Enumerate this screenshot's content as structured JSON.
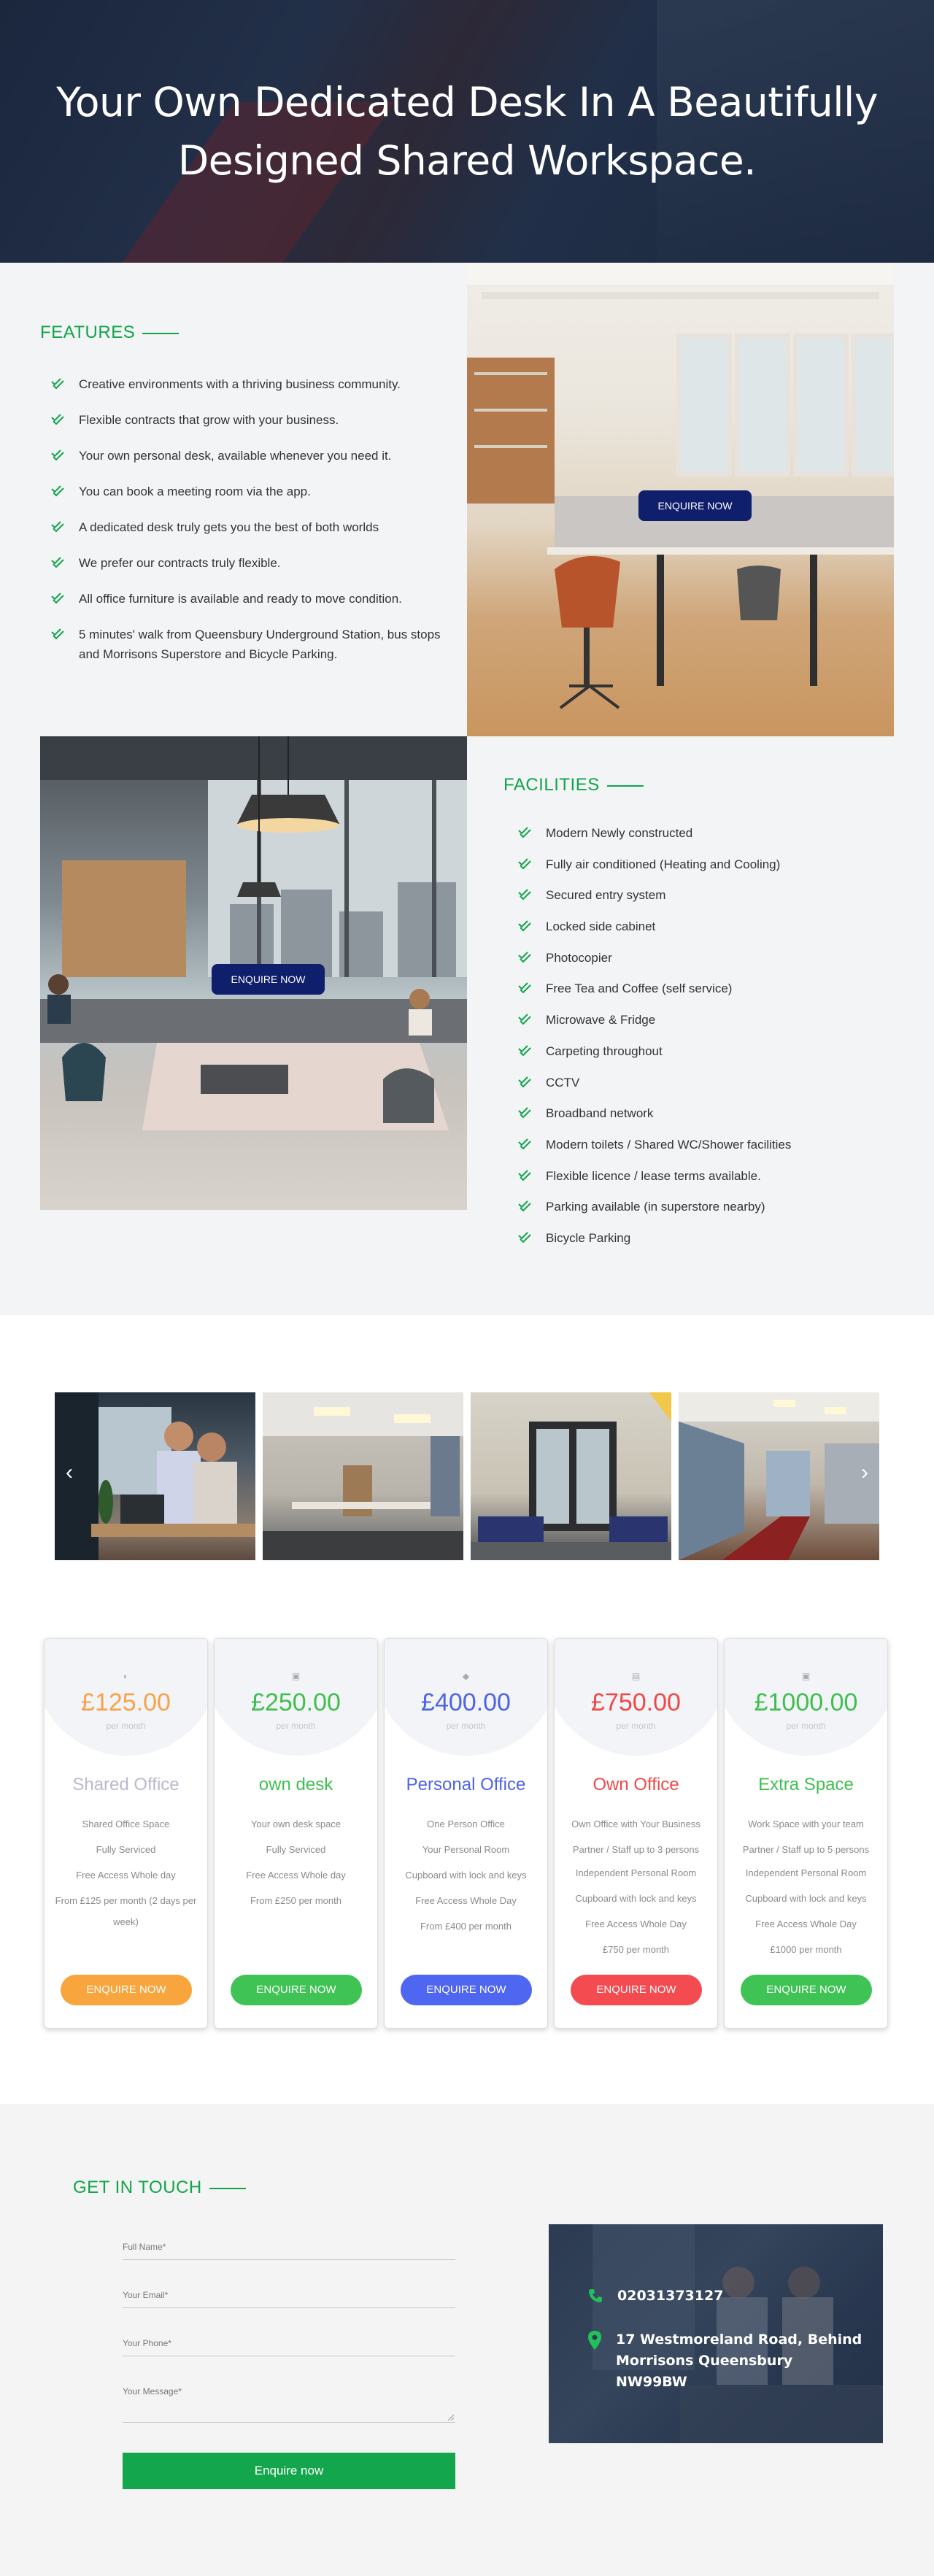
{
  "hero": {
    "title": "Your Own Dedicated Desk In A Beautifully Designed Shared Workspace."
  },
  "features": {
    "heading": "FEATURES",
    "items": [
      "Creative environments with a thriving business community.",
      "Flexible contracts that grow with your business.",
      "Your own personal desk, available whenever you need it.",
      "You can book a meeting room via the app.",
      "A dedicated desk truly gets you the best of both worlds",
      "We prefer our contracts truly flexible.",
      "All office furniture is available and ready to move condition.",
      "5 minutes' walk from Queensbury Underground Station, bus stops and Morrisons Superstore and Bicycle Parking."
    ],
    "enquire_label": "ENQUIRE NOW"
  },
  "facilities": {
    "heading": "FACILITIES",
    "items": [
      "Modern Newly constructed",
      "Fully air conditioned (Heating and Cooling)",
      "Secured entry system",
      "Locked side cabinet",
      "Photocopier",
      "Free Tea and Coffee (self service)",
      "Microwave & Fridge",
      "Carpeting throughout",
      "CCTV",
      "Broadband network",
      "Modern toilets / Shared WC/Shower facilities",
      "Flexible licence / lease terms available.",
      "Parking available (in superstore nearby)",
      "Bicycle Parking"
    ],
    "enquire_label": "ENQUIRE NOW"
  },
  "gallery": {
    "prev": "‹",
    "next": "›"
  },
  "pricing": [
    {
      "icon": "◐",
      "price": "£125.00",
      "per": "per month",
      "name": "Shared Office",
      "features": [
        "Shared Office Space",
        "Fully Serviced",
        "Free Access Whole day",
        "From £125 per month (2 days per week)"
      ],
      "button": "ENQUIRE NOW",
      "color": "#f7a24a",
      "name_color": "#b9b9cc",
      "btn_color": "#f7a53c"
    },
    {
      "icon": "▣",
      "price": "£250.00",
      "per": "per month",
      "name": "own desk",
      "features": [
        "Your own desk space",
        "Fully Serviced",
        "Free Access Whole day",
        "From £250 per month"
      ],
      "button": "ENQUIRE NOW",
      "color": "#3fbf4e",
      "name_color": "#3fbf4e",
      "btn_color": "#3fc355"
    },
    {
      "icon": "◆",
      "price": "£400.00",
      "per": "per month",
      "name": "Personal Office",
      "features": [
        "One Person Office",
        "Your Personal Room",
        "Cupboard with lock and keys",
        "Free Access Whole Day",
        "From £400 per month"
      ],
      "button": "ENQUIRE NOW",
      "color": "#4e63e6",
      "name_color": "#4e63e6",
      "btn_color": "#4f66f0"
    },
    {
      "icon": "▤",
      "price": "£750.00",
      "per": "per month",
      "name": "Own Office",
      "features": [
        "Own Office with Your Business",
        "Partner / Staff up to 3 persons",
        "Independent Personal Room",
        "Cupboard with lock and keys",
        "Free Access Whole Day",
        "£750 per month"
      ],
      "button": "ENQUIRE NOW",
      "color": "#f04848",
      "name_color": "#f04848",
      "btn_color": "#f44b50"
    },
    {
      "icon": "▣",
      "price": "£1000.00",
      "per": "per month",
      "name": "Extra Space",
      "features": [
        "Work Space with your team",
        "Partner / Staff up to 5 persons",
        "Independent Personal Room",
        "Cupboard with lock and keys",
        "Free Access Whole Day",
        "£1000 per month"
      ],
      "button": "ENQUIRE NOW",
      "color": "#3fbf4e",
      "name_color": "#3fbf4e",
      "btn_color": "#3fc355"
    }
  ],
  "contact": {
    "heading": "GET IN TOUCH",
    "fields": {
      "name": "Full Name*",
      "email": "Your Email*",
      "phone": "Your Phone*",
      "message": "Your Message*"
    },
    "submit": "Enquire now",
    "phone": "02031373127",
    "address": "17 Westmoreland Road, Behind Morrisons Queensbury NW99BW"
  },
  "colors": {
    "accent_green": "#11a54b",
    "navy_button": "#0f1f6b",
    "section_grey": "#f3f4f5"
  }
}
